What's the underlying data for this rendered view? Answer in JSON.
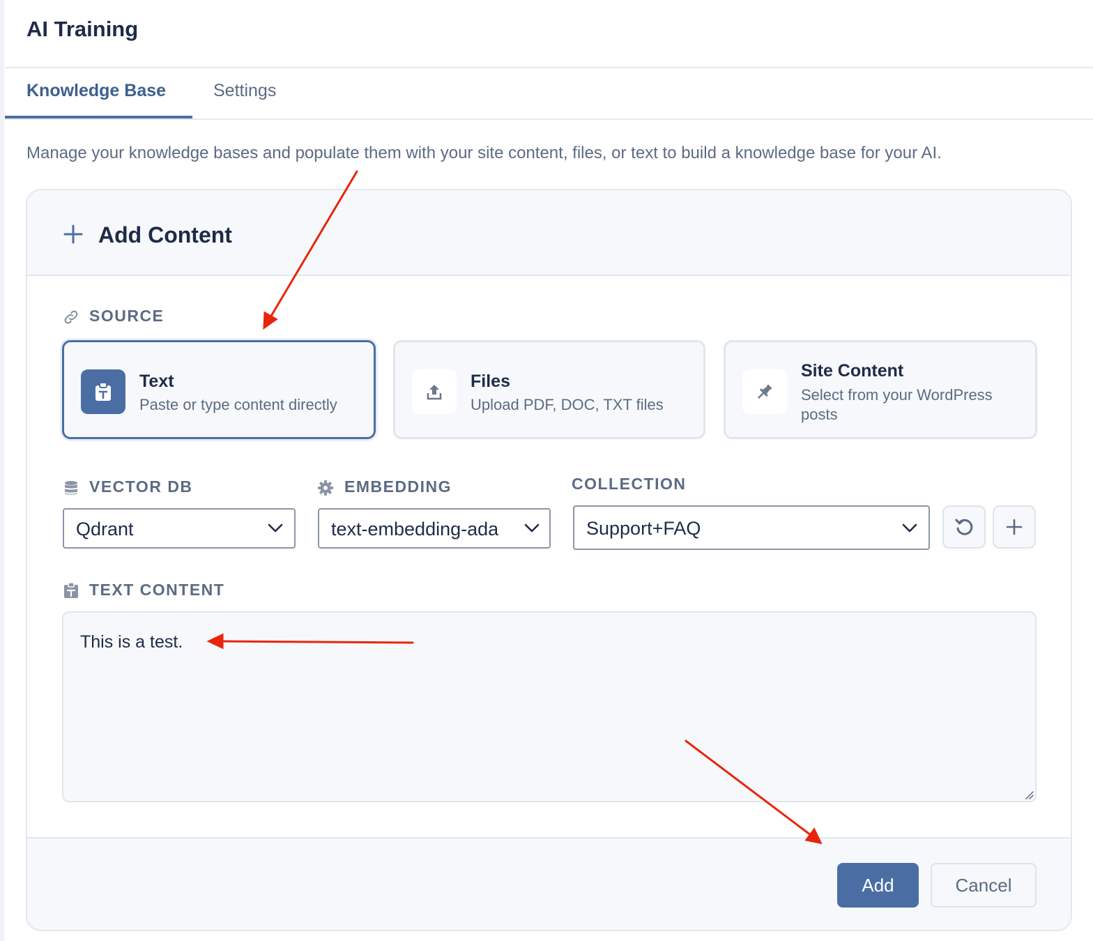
{
  "page": {
    "title": "AI Training"
  },
  "tabs": [
    {
      "label": "Knowledge Base",
      "active": true
    },
    {
      "label": "Settings",
      "active": false
    }
  ],
  "description": "Manage your knowledge bases and populate them with your site content, files, or text to build a knowledge base for your AI.",
  "add_content": {
    "title": "Add Content",
    "icon": "plus-icon",
    "source": {
      "label": "SOURCE",
      "icon": "link-icon",
      "options": [
        {
          "title": "Text",
          "description": "Paste or type content directly",
          "icon": "clipboard-icon",
          "selected": true
        },
        {
          "title": "Files",
          "description": "Upload PDF, DOC, TXT files",
          "icon": "upload-icon",
          "selected": false
        },
        {
          "title": "Site Content",
          "description_line1": "Select from your WordPress",
          "description_line2": "posts",
          "icon": "pin-icon",
          "selected": false
        }
      ]
    },
    "vector_db": {
      "label": "VECTOR DB",
      "icon": "database-icon",
      "value": "Qdrant"
    },
    "embedding": {
      "label": "EMBEDDING",
      "icon": "gear-icon",
      "value": "text-embedding-ada"
    },
    "collection": {
      "label": "COLLECTION",
      "value": "Support+FAQ",
      "refresh_icon": "refresh-icon",
      "add_icon": "plus-icon"
    },
    "text_content": {
      "label": "TEXT CONTENT",
      "icon": "clipboard-icon",
      "value": "This is a test."
    },
    "buttons": {
      "add": "Add",
      "cancel": "Cancel"
    }
  },
  "colors": {
    "accent": "#4a6ea4",
    "heading": "#1e2b47",
    "muted": "#5c6b83",
    "annotation_arrow": "#e8250c"
  }
}
